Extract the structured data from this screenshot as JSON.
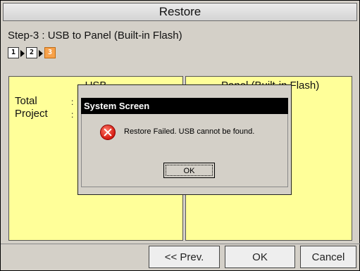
{
  "window": {
    "title": "Restore"
  },
  "step": {
    "label": "Step-3 : USB to Panel (Built-in Flash)",
    "indicators": [
      "1",
      "2",
      "3"
    ],
    "current": 3
  },
  "panels": {
    "left": {
      "title": "USB",
      "rows": [
        {
          "label": "Total",
          "colon": ":"
        },
        {
          "label": "Project",
          "colon": ":"
        }
      ]
    },
    "right": {
      "title": "Panel (Built-in Flash)"
    }
  },
  "buttons": {
    "prev": "<< Prev.",
    "ok": "OK",
    "cancel": "Cancel"
  },
  "dialog": {
    "title": "System Screen",
    "message": "Restore Failed. USB cannot be found.",
    "ok": "OK",
    "icon": "error-icon"
  },
  "colors": {
    "panel_bg": "#ffff99",
    "active_step": "#f7a14a",
    "dialog_caption": "#000000"
  }
}
